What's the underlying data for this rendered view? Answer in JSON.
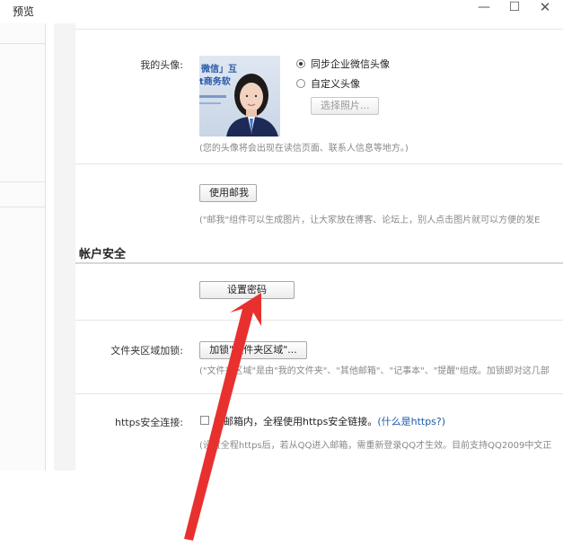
{
  "window": {
    "title": "预览",
    "min_glyph": "—",
    "max_glyph": "☐",
    "close_glyph": "✕"
  },
  "avatar_section": {
    "label": "我的头像:",
    "image_text_line1": "微信」互",
    "image_text_line2": "t商务软",
    "option_sync": "同步企业微信头像",
    "option_custom": "自定义头像",
    "choose_photo_button": "选择照片...",
    "hint": "(您的头像将会出现在读信页面、联系人信息等地方。)"
  },
  "mail_me_section": {
    "button": "使用邮我",
    "hint": "(\"邮我\"组件可以生成图片，让大家放在博客、论坛上，别人点击图片就可以方便的发E"
  },
  "account_security": {
    "heading": "帐户安全",
    "set_password_button": "设置密码"
  },
  "folder_lock": {
    "label": "文件夹区域加锁:",
    "button": "加锁\"文件夹区域\"...",
    "hint": "(\"文件夹区域\"是由\"我的文件夹\"、\"其他邮箱\"、\"记事本\"、\"提醒\"组成。加锁即对这几部"
  },
  "https": {
    "label": "https安全连接:",
    "checkbox_text": "在邮箱内，全程使用https安全链接。",
    "link": "(什么是https?)",
    "hint": "(设置全程https后，若从QQ进入邮箱，需重新登录QQ才生效。目前支持QQ2009中文正"
  },
  "colors": {
    "arrow": "#e8312f",
    "link": "#1e5aa8"
  }
}
